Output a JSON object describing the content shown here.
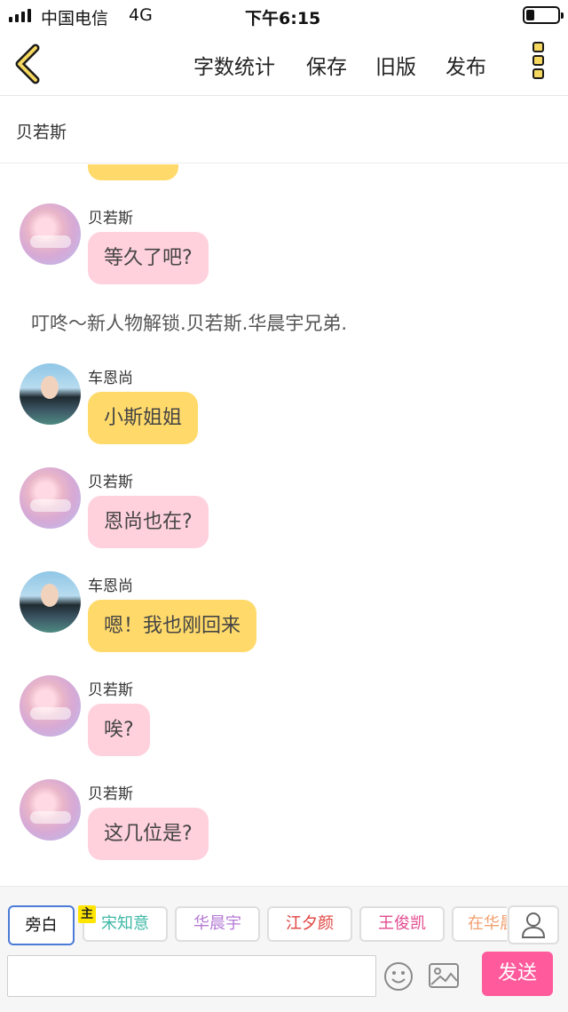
{
  "status_bar": {
    "carrier": "中国电信",
    "network": "4G",
    "time": "下午6:15"
  },
  "nav": {
    "back_icon": "chevron-left-icon",
    "buttons": [
      "字数统计",
      "保存",
      "旧版",
      "发布"
    ],
    "more_icon": "more-vertical-icon",
    "accent_color": "#f6d860"
  },
  "title": "贝若斯",
  "messages": [
    {
      "type": "chat",
      "speaker": "贝若斯",
      "text": "等久了吧?",
      "style": "pink"
    },
    {
      "type": "narration",
      "text": "叮咚～新人物解锁.贝若斯.华晨宇兄弟."
    },
    {
      "type": "chat",
      "speaker": "车恩尚",
      "text": "小斯姐姐",
      "style": "yellow"
    },
    {
      "type": "chat",
      "speaker": "贝若斯",
      "text": "恩尚也在?",
      "style": "pink"
    },
    {
      "type": "chat",
      "speaker": "车恩尚",
      "text": "嗯！我也刚回来",
      "style": "yellow"
    },
    {
      "type": "chat",
      "speaker": "贝若斯",
      "text": "唉?",
      "style": "pink"
    },
    {
      "type": "chat",
      "speaker": "贝若斯",
      "text": "这几位是?",
      "style": "pink"
    }
  ],
  "bottom": {
    "chips": [
      {
        "label": "旁白",
        "color": "#222222",
        "selected": true
      },
      {
        "label": "宋知意",
        "color": "#3fb8a6"
      },
      {
        "label": "华晨宇",
        "color": "#b57ad6"
      },
      {
        "label": "江夕颜",
        "color": "#e0433f"
      },
      {
        "label": "王俊凯",
        "color": "#e34a8f"
      },
      {
        "label": "在华晨",
        "color": "#f0a070"
      }
    ],
    "host_badge": "主",
    "contact_icon": "person-icon",
    "emoji_icon": "smiley-icon",
    "image_icon": "image-icon",
    "input_value": "",
    "send_label": "发送",
    "send_color": "#ff5a9b"
  }
}
